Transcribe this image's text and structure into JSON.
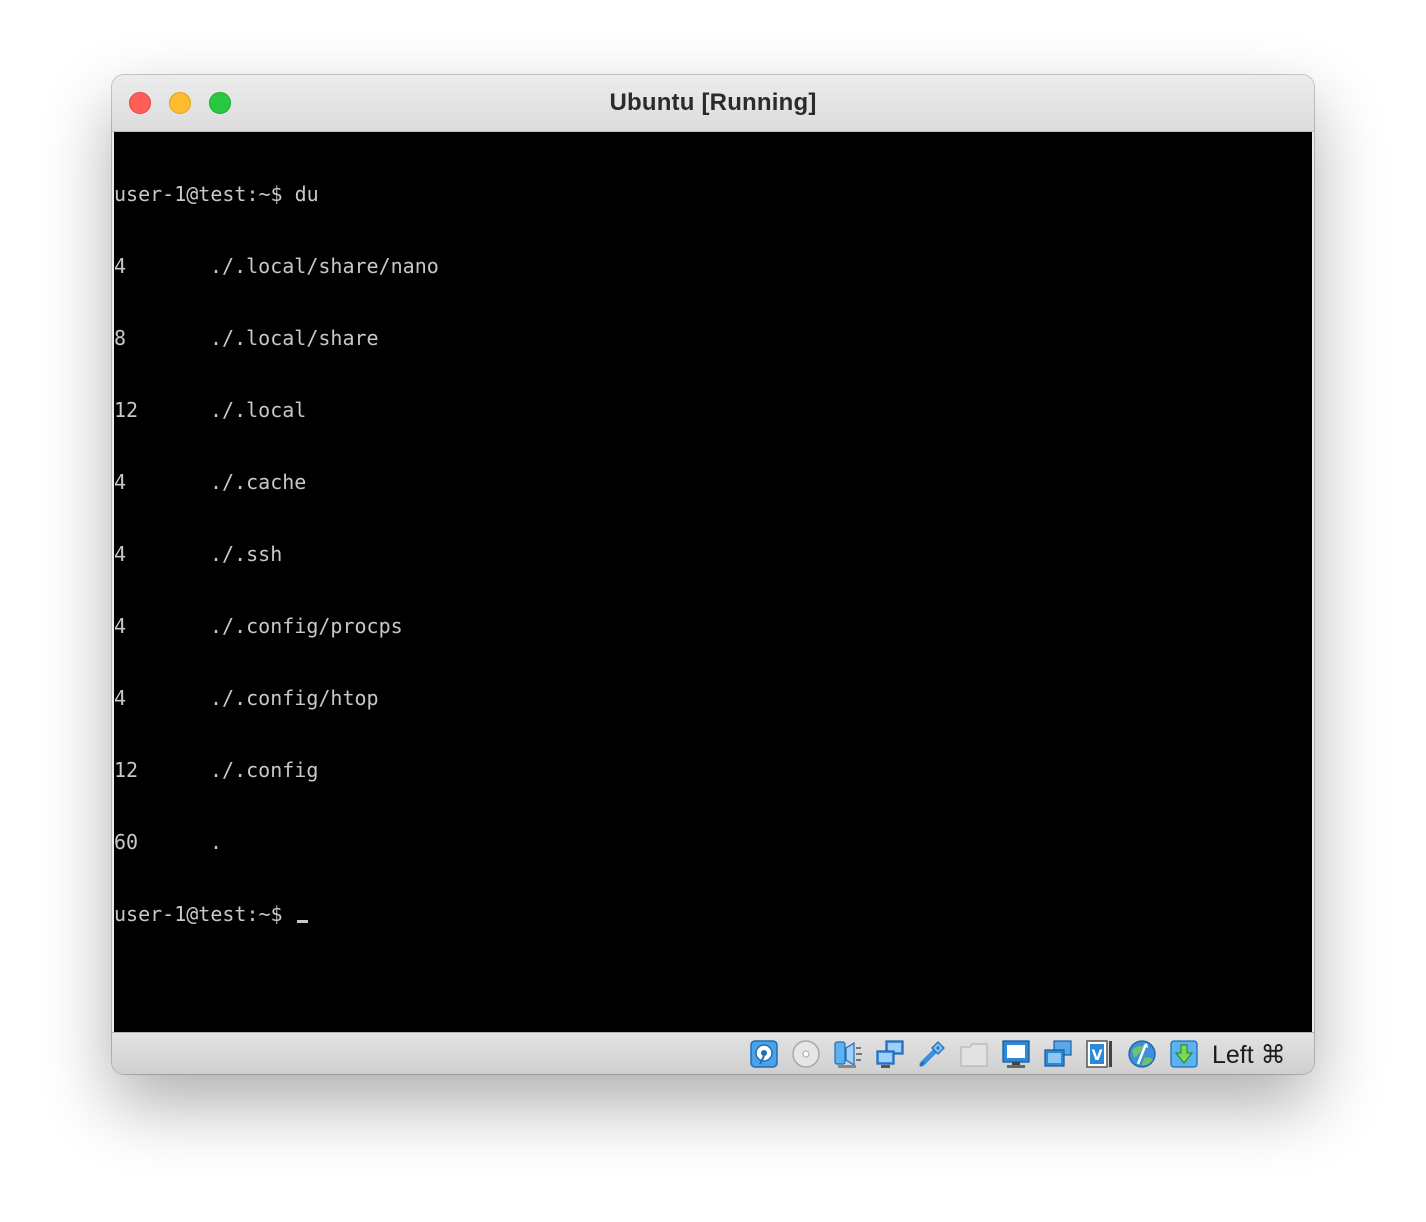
{
  "window": {
    "title": "Ubuntu [Running]"
  },
  "terminal": {
    "prompt": "user-1@test:~$",
    "command": "du",
    "rows": [
      {
        "size": "4",
        "path": "./.local/share/nano"
      },
      {
        "size": "8",
        "path": "./.local/share"
      },
      {
        "size": "12",
        "path": "./.local"
      },
      {
        "size": "4",
        "path": "./.cache"
      },
      {
        "size": "4",
        "path": "./.ssh"
      },
      {
        "size": "4",
        "path": "./.config/procps"
      },
      {
        "size": "4",
        "path": "./.config/htop"
      },
      {
        "size": "12",
        "path": "./.config"
      },
      {
        "size": "60",
        "path": "."
      }
    ]
  },
  "statusbar": {
    "icons": [
      "hard-disk-icon",
      "optical-drive-icon",
      "audio-icon",
      "network-icon",
      "usb-icon",
      "shared-folder-icon",
      "display-icon",
      "recording-icon",
      "cpu-virtualization-icon",
      "mouse-integration-icon",
      "keyboard-capture-icon"
    ],
    "host_key": "Left ⌘"
  },
  "colors": {
    "terminal_bg": "#000000",
    "terminal_fg": "#c8c8c8",
    "close": "#ff5f57",
    "minimize": "#febc2e",
    "maximize": "#28c840",
    "icon_blue": "#2a8ad8"
  }
}
